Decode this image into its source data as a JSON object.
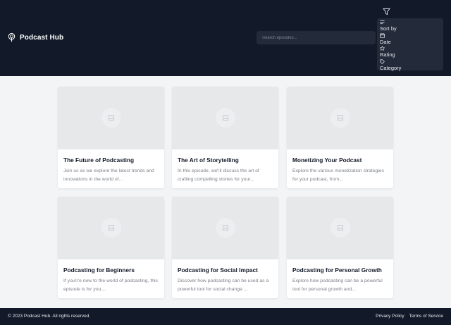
{
  "header": {
    "brand_title": "Podcast Hub",
    "brand_icon": "podcast-icon",
    "search_placeholder": "Search episodes...",
    "filter_icon": "filter-icon"
  },
  "sort_menu": {
    "items": [
      {
        "label": "Sort by",
        "icon": "list-icon"
      },
      {
        "label": "Date",
        "icon": "calendar-icon"
      },
      {
        "label": "Rating",
        "icon": "star-icon"
      },
      {
        "label": "Category",
        "icon": "tag-icon"
      }
    ]
  },
  "episodes": [
    {
      "title": "The Future of Podcasting",
      "description": "Join us as we explore the latest trends and innovations in the world of..."
    },
    {
      "title": "The Art of Storytelling",
      "description": "In this episode, we\\'ll discuss the art of crafting compelling stories for your..."
    },
    {
      "title": "Monetizing Your Podcast",
      "description": "Explore the various monetization strategies for your podcast, from..."
    },
    {
      "title": "Podcasting for Beginners",
      "description": "If you\\'re new to the world of podcasting, this episode is for you...."
    },
    {
      "title": "Podcasting for Social Impact",
      "description": "Discover how podcasting can be used as a powerful tool for social change...."
    },
    {
      "title": "Podcasting for Personal Growth",
      "description": "Explore how podcasting can be a powerful tool for personal growth and..."
    }
  ],
  "footer": {
    "copyright": "© 2023 Podcast Hub. All rights reserved.",
    "privacy_label": "Privacy Policy",
    "terms_label": "Terms of Service"
  },
  "colors": {
    "header_bg": "#121a2a",
    "page_bg": "#f3f4f6",
    "menu_bg": "#232b3b",
    "thumbnail_bg": "#e7e8ea"
  }
}
